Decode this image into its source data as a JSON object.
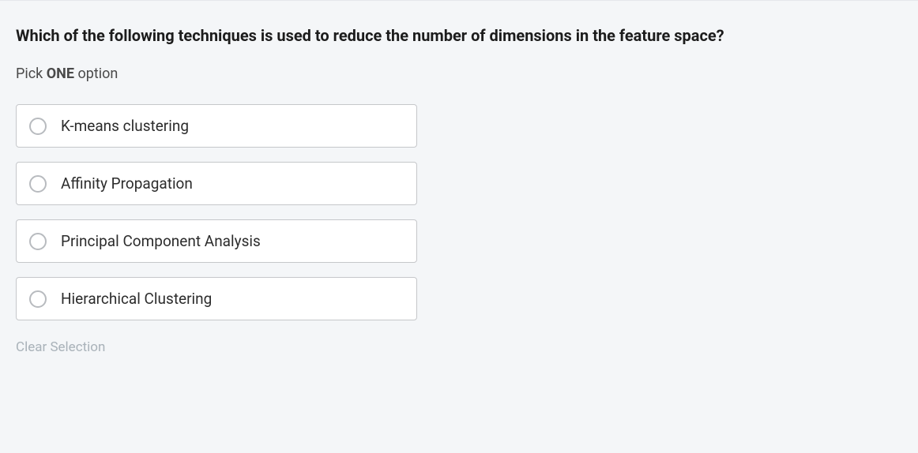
{
  "question": "Which of the following techniques is used to reduce the number of dimensions in the feature space?",
  "instruction_prefix": "Pick ",
  "instruction_bold": "ONE",
  "instruction_suffix": " option",
  "options": [
    {
      "label": "K-means clustering"
    },
    {
      "label": "Affinity Propagation"
    },
    {
      "label": "Principal Component Analysis"
    },
    {
      "label": "Hierarchical Clustering"
    }
  ],
  "clear_label": "Clear Selection"
}
